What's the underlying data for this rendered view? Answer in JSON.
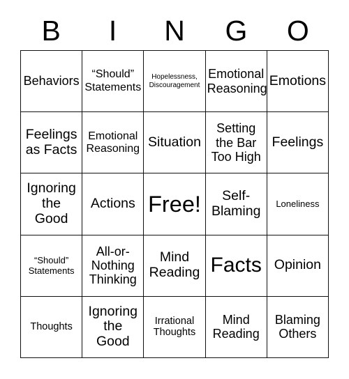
{
  "card": {
    "type": "bingo-card",
    "background_color": "#ffffff",
    "text_color": "#000000",
    "border_color": "#111111",
    "columns": 5,
    "rows": 5,
    "header": {
      "letters": [
        "B",
        "I",
        "N",
        "G",
        "O"
      ]
    },
    "free_space": {
      "label": "Free!",
      "row": 3,
      "column": 3
    },
    "cells": [
      [
        {
          "text": "Behaviors",
          "size": "l"
        },
        {
          "text": "“Should”\nStatements",
          "size": "m"
        },
        {
          "text": "Hopelessness,\nDiscouragement",
          "size": "xxs"
        },
        {
          "text": "Emotional\nReasoning",
          "size": "l"
        },
        {
          "text": "Emotions",
          "size": "xl"
        }
      ],
      [
        {
          "text": "Feelings\nas Facts",
          "size": "xl"
        },
        {
          "text": "Emotional\nReasoning",
          "size": "m"
        },
        {
          "text": "Situation",
          "size": "xl"
        },
        {
          "text": "Setting\nthe Bar\nToo High",
          "size": "l"
        },
        {
          "text": "Feelings",
          "size": "xl"
        }
      ],
      [
        {
          "text": "Ignoring\nthe\nGood",
          "size": "xl"
        },
        {
          "text": "Actions",
          "size": "xl"
        },
        {
          "text": "Free!",
          "size": "free"
        },
        {
          "text": "Self-\nBlaming",
          "size": "xl"
        },
        {
          "text": "Loneliness",
          "size": "xs"
        }
      ],
      [
        {
          "text": "“Should”\nStatements",
          "size": "xs"
        },
        {
          "text": "All-or-\nNothing\nThinking",
          "size": "l"
        },
        {
          "text": "Mind\nReading",
          "size": "xl"
        },
        {
          "text": "Facts",
          "size": "xxl"
        },
        {
          "text": "Opinion",
          "size": "xl"
        }
      ],
      [
        {
          "text": "Thoughts",
          "size": "s"
        },
        {
          "text": "Ignoring\nthe\nGood",
          "size": "xl"
        },
        {
          "text": "Irrational\nThoughts",
          "size": "s"
        },
        {
          "text": "Mind\nReading",
          "size": "l"
        },
        {
          "text": "Blaming\nOthers",
          "size": "l"
        }
      ]
    ]
  }
}
